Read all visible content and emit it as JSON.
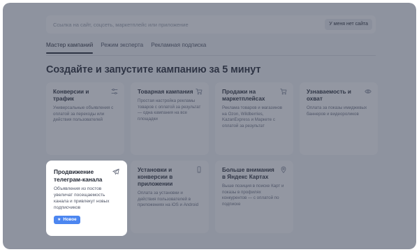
{
  "search": {
    "placeholder": "Ссылка на сайт, соцсеть, маркетплейс или приложение",
    "no_site_label": "У меня нет сайта"
  },
  "tabs": [
    {
      "label": "Мастер кампаний",
      "active": true
    },
    {
      "label": "Режим эксперта",
      "active": false
    },
    {
      "label": "Рекламная подписка",
      "active": false
    }
  ],
  "heading": "Создайте и запустите кампанию за 5 минут",
  "cards": [
    {
      "title": "Конверсии и трафик",
      "description": "Универсальные объявления с оплатой за переходы или действия пользователей",
      "icon": "conversion-sliders-icon"
    },
    {
      "title": "Товарная кампания",
      "description": "Простая настройка рекламы товаров с оплатой за результат — одна кампания на все площадки",
      "icon": "cart-icon"
    },
    {
      "title": "Продажи на маркетплейсах",
      "description": "Реклама товаров и магазинов на Ozon, Wildberries, KazanExpress и Маркете с оплатой за результат",
      "icon": "cart-icon"
    },
    {
      "title": "Узнаваемость и охват",
      "description": "Оплата за показы имиджевых баннеров и видеороликов",
      "icon": "eye-icon"
    },
    {
      "title": "Продвижение телеграм-канала",
      "description": "Объявления из постов увеличат посещаемость канала и привлекут новых подписчиков",
      "icon": "telegram-icon",
      "badge": "Новое"
    },
    {
      "title": "Установки и конверсии в приложении",
      "description": "Оплата за установки и действия пользователей в приложениях на iOS и Android",
      "icon": "phone-icon"
    },
    {
      "title": "Больше внимания в Яндекс Картах",
      "description": "Выше позиция в поиске Карт и показы в профилях конкурентов — с оплатой по подписке",
      "icon": "map-pin-icon"
    }
  ],
  "colors": {
    "panel_bg": "#f4f5f8",
    "overlay": "rgba(58,66,86,0.55)",
    "badge_bg": "#4c86f0",
    "text": "#1f2430"
  }
}
